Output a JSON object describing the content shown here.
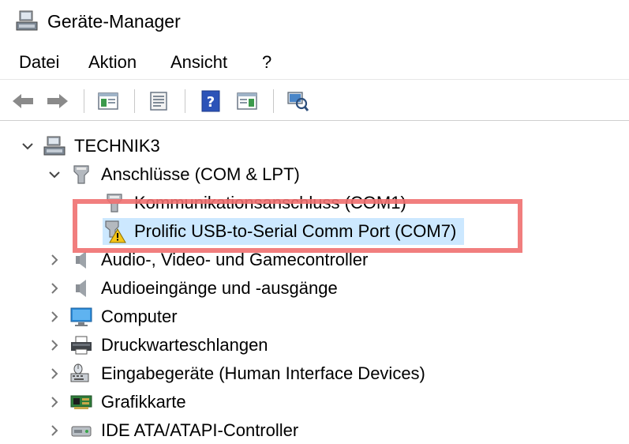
{
  "window": {
    "title": "Geräte-Manager"
  },
  "menu": [
    "Datei",
    "Aktion",
    "Ansicht",
    "?"
  ],
  "toolbar": {
    "buttons": [
      "back-icon",
      "forward-icon",
      "show-hide-console-tree-icon",
      "properties-icon",
      "help-icon",
      "action-pane-icon",
      "scan-hardware-icon"
    ]
  },
  "tree": {
    "root": "TECHNIK3",
    "ports_category": "Anschlüsse (COM & LPT)",
    "ports_children": [
      "Kommunikationsanschluss (COM1)",
      "Prolific USB-to-Serial Comm Port (COM7)"
    ],
    "categories": [
      "Audio-, Video- und Gamecontroller",
      "Audioeingänge und -ausgänge",
      "Computer",
      "Druckwarteschlangen",
      "Eingabegeräte (Human Interface Devices)",
      "Grafikkarte",
      "IDE ATA/ATAPI-Controller"
    ]
  },
  "colors": {
    "selection": "#cce8ff",
    "highlight_border": "#f07070",
    "warning": "#f5c518"
  }
}
